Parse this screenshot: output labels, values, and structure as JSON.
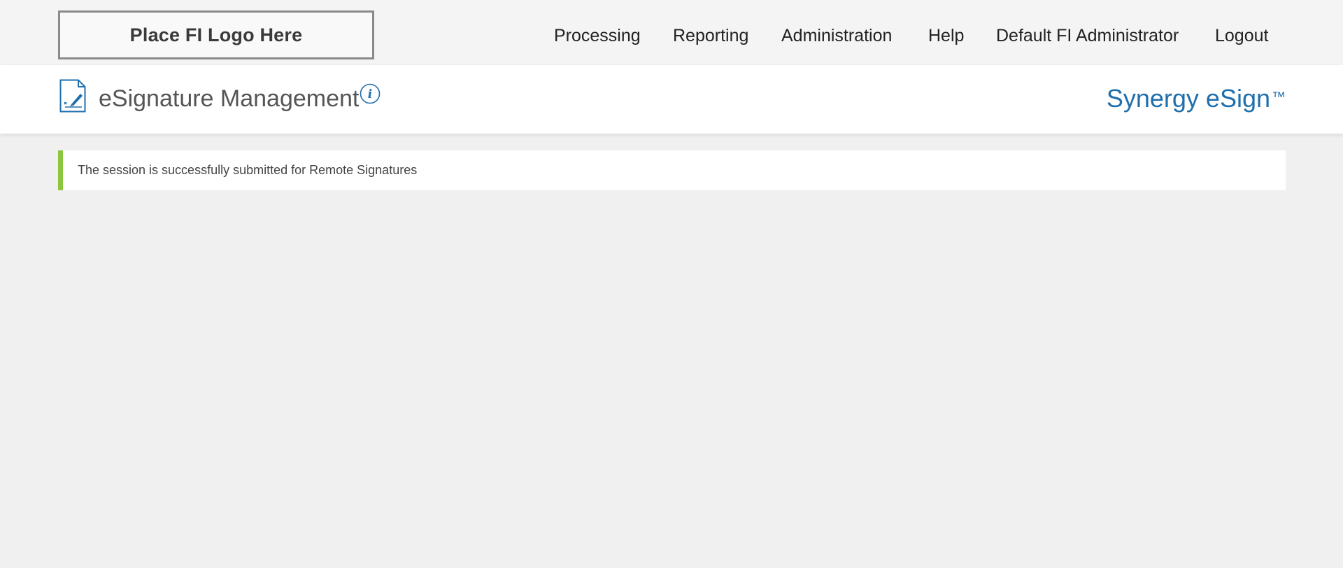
{
  "logo": {
    "text": "Place FI Logo Here"
  },
  "nav": {
    "items": [
      {
        "label": "Processing"
      },
      {
        "label": "Reporting"
      },
      {
        "label": "Administration"
      },
      {
        "label": "Help"
      },
      {
        "label": "Default FI Administrator"
      },
      {
        "label": "Logout"
      }
    ]
  },
  "header": {
    "title": "eSignature Management",
    "brand": "Synergy eSign",
    "brand_mark": "™",
    "icon": "document-signature-icon",
    "info_icon": "info-icon"
  },
  "alert": {
    "message": "The session is successfully submitted for Remote Signatures",
    "accent_color": "#8cc63f"
  },
  "colors": {
    "brand": "#1f6fad",
    "topbar_bg": "#f4f4f4",
    "page_bg": "#f0f0f0"
  }
}
